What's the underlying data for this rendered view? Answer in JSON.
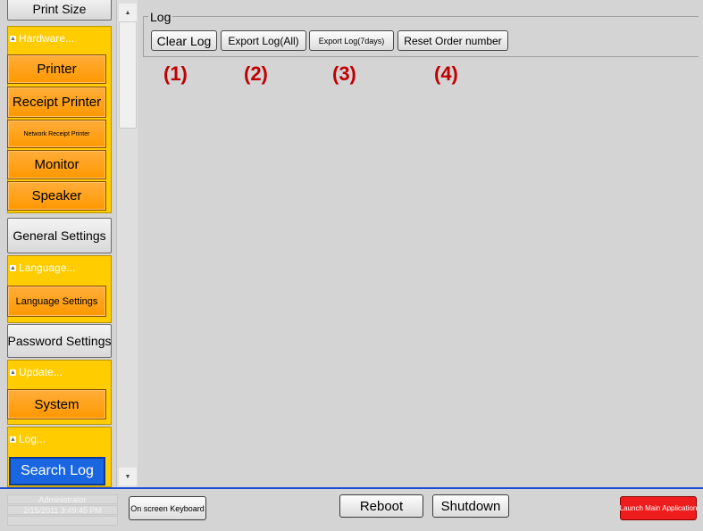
{
  "sidebar": {
    "print_size_label": "Print Size",
    "hardware": {
      "header": "Hardware...",
      "items": [
        "Printer",
        "Receipt Printer",
        "Network Receipt Printer",
        "Monitor",
        "Speaker"
      ]
    },
    "general_settings_label": "General Settings",
    "language": {
      "header": "Language...",
      "items": [
        "Language Settings"
      ]
    },
    "password_settings_label": "Password Settings",
    "update": {
      "header": "Update...",
      "items": [
        "System"
      ]
    },
    "log": {
      "header": "Log...",
      "items": [
        "Search Log"
      ]
    }
  },
  "log_panel": {
    "title": "Log",
    "buttons": [
      "Clear Log",
      "Export Log(All)",
      "Export Log(7days)",
      "Reset Order number"
    ],
    "markers": [
      "(1)",
      "(2)",
      "(3)",
      "(4)"
    ]
  },
  "bottom_bar": {
    "user": "Administrator",
    "datetime": "2/15/2011 3:49:45 PM",
    "keyboard_label": "On screen Keyboard",
    "reboot_label": "Reboot",
    "shutdown_label": "Shutdown",
    "launch_label": "Launch Main Application"
  },
  "icons": {
    "scroll_up": "chevron-up-icon",
    "scroll_down": "chevron-down-icon",
    "group_collapse": "chevron-up-icon"
  },
  "colors": {
    "group_bg": "#ffcc00",
    "orange_button": "#ff9800",
    "selected_button": "#1a66e0",
    "marker": "#c00000",
    "launch_button": "#ee1c1c",
    "bottom_border": "#1a4bd6"
  }
}
